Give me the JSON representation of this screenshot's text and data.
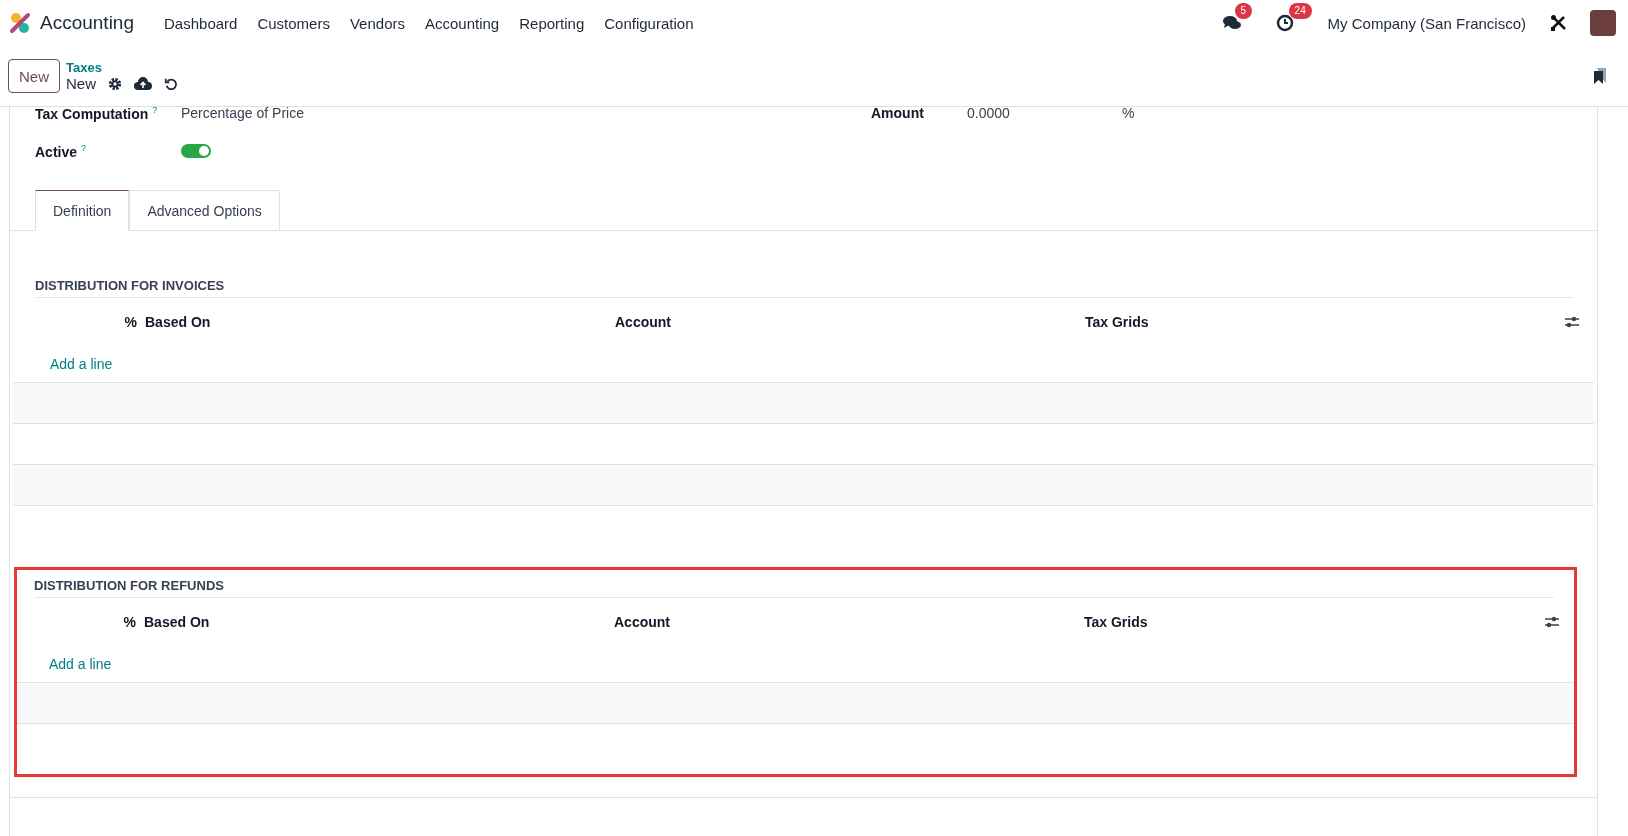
{
  "navbar": {
    "app_name": "Accounting",
    "menu": [
      "Dashboard",
      "Customers",
      "Vendors",
      "Accounting",
      "Reporting",
      "Configuration"
    ],
    "messages_count": "5",
    "activities_count": "24",
    "company": "My Company (San Francisco)"
  },
  "control_panel": {
    "new_button": "New",
    "breadcrumb": "Taxes",
    "record": "New"
  },
  "form": {
    "fields": [
      {
        "label": "Tax Computation",
        "help": "?",
        "value": "Percentage of Price"
      },
      {
        "label": "Amount",
        "value": "0.0000",
        "unit": "%"
      }
    ],
    "active": {
      "label": "Active",
      "help": "?",
      "on": true
    },
    "tabs": [
      {
        "label": "Definition",
        "selected": true
      },
      {
        "label": "Advanced Options",
        "selected": false
      }
    ],
    "sections": [
      {
        "title": "DISTRIBUTION FOR INVOICES",
        "highlighted": false,
        "columns": [
          "%",
          "Based On",
          "Account",
          "Tax Grids"
        ],
        "add_line": "Add a line"
      },
      {
        "title": "DISTRIBUTION FOR REFUNDS",
        "highlighted": true,
        "columns": [
          "%",
          "Based On",
          "Account",
          "Tax Grids"
        ],
        "add_line": "Add a line"
      }
    ]
  }
}
